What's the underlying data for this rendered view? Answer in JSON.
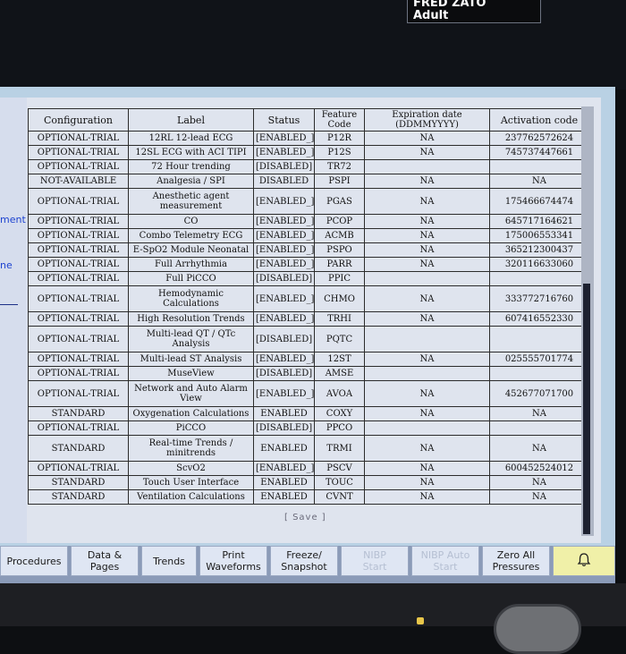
{
  "top_box": {
    "line1": "FRED ZATO",
    "line2": "Adult"
  },
  "left_fragments": [
    "ment",
    "ne"
  ],
  "columns": [
    "Configuration",
    "Label",
    "Status",
    "Feature\nCode",
    "Expiration date\n(DDMMYYYY)",
    "Activation code"
  ],
  "rows": [
    {
      "config": "OPTIONAL-TRIAL",
      "label": "12RL 12-lead ECG",
      "status": "[ENABLED_]",
      "code": "P12R",
      "exp": "NA",
      "act": "237762572624"
    },
    {
      "config": "OPTIONAL-TRIAL",
      "label": "12SL ECG with ACI TIPI",
      "status": "[ENABLED_]",
      "code": "P12S",
      "exp": "NA",
      "act": "745737447661"
    },
    {
      "config": "OPTIONAL-TRIAL",
      "label": "72 Hour trending",
      "status": "[DISABLED]",
      "code": "TR72",
      "exp": "",
      "act": ""
    },
    {
      "config": "NOT-AVAILABLE",
      "label": "Analgesia / SPI",
      "status": "DISABLED",
      "code": "PSPI",
      "exp": "NA",
      "act": "NA"
    },
    {
      "config": "OPTIONAL-TRIAL",
      "label": "Anesthetic agent\nmeasurement",
      "status": "[ENABLED_]",
      "code": "PGAS",
      "exp": "NA",
      "act": "175466674474",
      "tall": true
    },
    {
      "config": "OPTIONAL-TRIAL",
      "label": "CO",
      "status": "[ENABLED_]",
      "code": "PCOP",
      "exp": "NA",
      "act": "645717164621"
    },
    {
      "config": "OPTIONAL-TRIAL",
      "label": "Combo Telemetry ECG",
      "status": "[ENABLED_]",
      "code": "ACMB",
      "exp": "NA",
      "act": "175006553341"
    },
    {
      "config": "OPTIONAL-TRIAL",
      "label": "E-SpO2 Module Neonatal",
      "status": "[ENABLED_]",
      "code": "PSPO",
      "exp": "NA",
      "act": "365212300437"
    },
    {
      "config": "OPTIONAL-TRIAL",
      "label": "Full Arrhythmia",
      "status": "[ENABLED_]",
      "code": "PARR",
      "exp": "NA",
      "act": "320116633060"
    },
    {
      "config": "OPTIONAL-TRIAL",
      "label": "Full PiCCO",
      "status": "[DISABLED]",
      "code": "PPIC",
      "exp": "",
      "act": ""
    },
    {
      "config": "OPTIONAL-TRIAL",
      "label": "Hemodynamic\nCalculations",
      "status": "[ENABLED_]",
      "code": "CHMO",
      "exp": "NA",
      "act": "333772716760",
      "tall": true
    },
    {
      "config": "OPTIONAL-TRIAL",
      "label": "High Resolution Trends",
      "status": "[ENABLED_]",
      "code": "TRHI",
      "exp": "NA",
      "act": "607416552330"
    },
    {
      "config": "OPTIONAL-TRIAL",
      "label": "Multi-lead QT / QTc\nAnalysis",
      "status": "[DISABLED]",
      "code": "PQTC",
      "exp": "",
      "act": "",
      "tall": true
    },
    {
      "config": "OPTIONAL-TRIAL",
      "label": "Multi-lead ST Analysis",
      "status": "[ENABLED_]",
      "code": "12ST",
      "exp": "NA",
      "act": "025555701774"
    },
    {
      "config": "OPTIONAL-TRIAL",
      "label": "MuseView",
      "status": "[DISABLED]",
      "code": "AMSE",
      "exp": "",
      "act": ""
    },
    {
      "config": "OPTIONAL-TRIAL",
      "label": "Network and Auto Alarm\nView",
      "status": "[ENABLED_]",
      "code": "AVOA",
      "exp": "NA",
      "act": "452677071700",
      "tall": true
    },
    {
      "config": "STANDARD",
      "label": "Oxygenation Calculations",
      "status": "ENABLED",
      "code": "COXY",
      "exp": "NA",
      "act": "NA"
    },
    {
      "config": "OPTIONAL-TRIAL",
      "label": "PiCCO",
      "status": "[DISABLED]",
      "code": "PPCO",
      "exp": "",
      "act": ""
    },
    {
      "config": "STANDARD",
      "label": "Real-time Trends /\nminitrends",
      "status": "ENABLED",
      "code": "TRMI",
      "exp": "NA",
      "act": "NA",
      "tall": true
    },
    {
      "config": "OPTIONAL-TRIAL",
      "label": "ScvO2",
      "status": "[ENABLED_]",
      "code": "PSCV",
      "exp": "NA",
      "act": "600452524012"
    },
    {
      "config": "STANDARD",
      "label": "Touch User Interface",
      "status": "ENABLED",
      "code": "TOUC",
      "exp": "NA",
      "act": "NA"
    },
    {
      "config": "STANDARD",
      "label": "Ventilation Calculations",
      "status": "ENABLED",
      "code": "CVNT",
      "exp": "NA",
      "act": "NA"
    }
  ],
  "save_label": "[ Save ]",
  "cursor_mark": "✕",
  "buttons": [
    {
      "label": "Procedures",
      "enabled": true
    },
    {
      "label": "Data &\nPages",
      "enabled": true
    },
    {
      "label": "Trends",
      "enabled": true
    },
    {
      "label": "Print\nWaveforms",
      "enabled": true
    },
    {
      "label": "Freeze/\nSnapshot",
      "enabled": true
    },
    {
      "label": "NIBP\nStart",
      "enabled": false
    },
    {
      "label": "NIBP Auto\nStart",
      "enabled": false
    },
    {
      "label": "Zero All\nPressures",
      "enabled": true
    },
    {
      "label": "",
      "enabled": true,
      "icon": "alarm-bell-icon"
    }
  ],
  "colors": {
    "accent_blue": "#1e43d0",
    "alarm_button": "#f0f0a8",
    "screen_bg": "#b9d1e4"
  }
}
